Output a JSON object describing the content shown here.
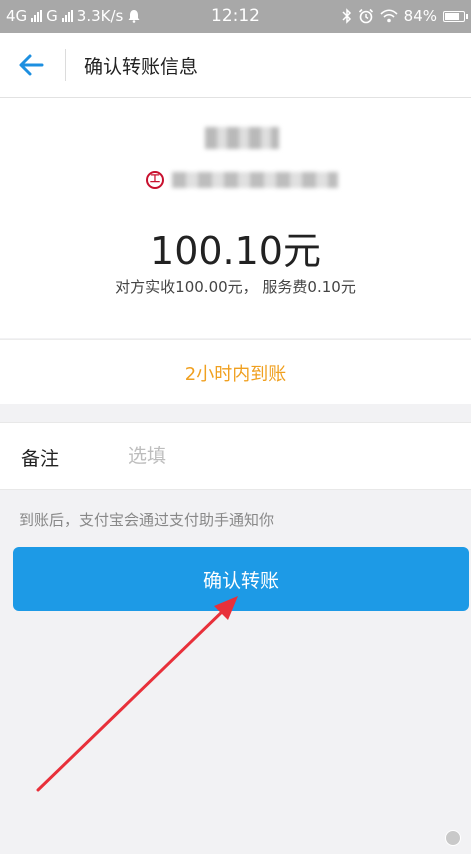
{
  "status_bar": {
    "network_1": "4G",
    "network_2": "G",
    "speed": "3.3K/s",
    "time": "12:12",
    "battery": "84%",
    "battery_level": 0.84
  },
  "header": {
    "title": "确认转账信息"
  },
  "payee": {
    "amount": "100.10元",
    "fee_detail": "对方实收100.00元， 服务费0.10元"
  },
  "arrival": {
    "text": "2小时内到账",
    "color": "#f0a020"
  },
  "remark": {
    "label": "备注",
    "placeholder": "选填",
    "value": ""
  },
  "notice": "到账后，支付宝会通过支付助手通知你",
  "confirm_button": {
    "label": "确认转账",
    "color": "#1d9ae6"
  },
  "icons": [
    "back-arrow-icon",
    "bank-logo-icon",
    "bluetooth-icon",
    "alarm-icon",
    "wifi-icon",
    "battery-icon"
  ]
}
